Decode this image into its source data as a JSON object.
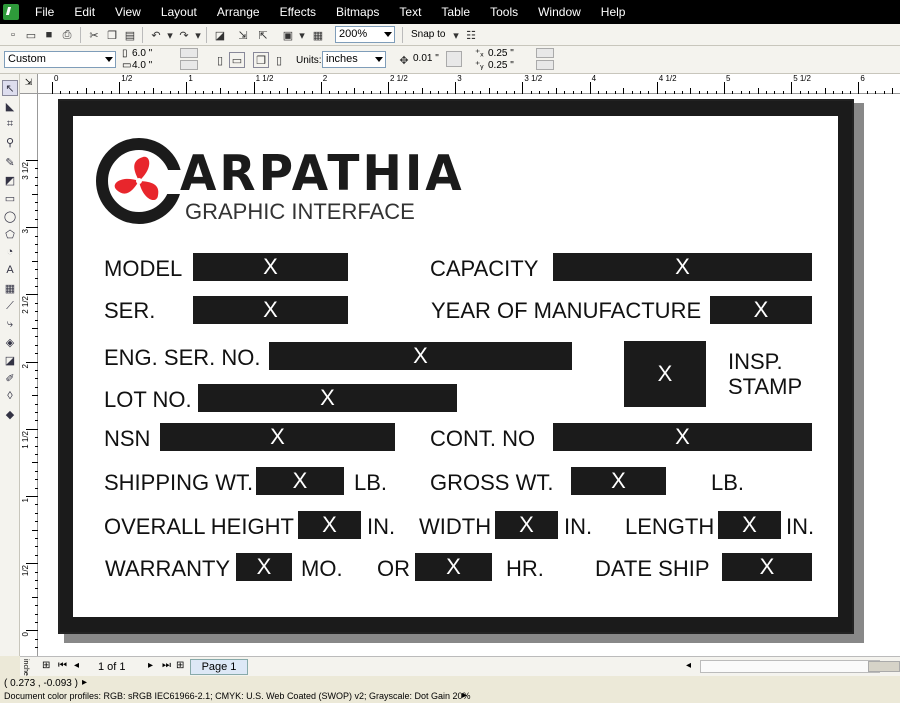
{
  "menu": [
    "File",
    "Edit",
    "View",
    "Layout",
    "Arrange",
    "Effects",
    "Bitmaps",
    "Text",
    "Table",
    "Tools",
    "Window",
    "Help"
  ],
  "toolbar": {
    "zoom": "200%",
    "snap_to": "Snap to",
    "page_size": "Custom",
    "width": "6.0 \"",
    "height": "4.0 \"",
    "units_label": "Units:",
    "units": "inches",
    "nudge": "0.01 \"",
    "dup_x": "0.25 \"",
    "dup_y": "0.25 \""
  },
  "ruler": {
    "unit": "inches",
    "top_labels": [
      "0",
      "1/2",
      "1",
      "1 1/2",
      "2",
      "2 1/2",
      "3",
      "3 1/2",
      "4",
      "4 1/2",
      "5",
      "5 1/2",
      "6"
    ],
    "left_labels": [
      "3 1/2",
      "3",
      "2 1/2",
      "2",
      "1 1/2",
      "1",
      "1/2",
      "0"
    ]
  },
  "label": {
    "brand": "ARPATHIA",
    "tagline": "GRAPHIC INTERFACE",
    "placeholder": "X",
    "fields": {
      "model": "MODEL",
      "capacity": "CAPACITY",
      "ser": "SER.",
      "year": "YEAR OF MANUFACTURE",
      "eng_ser": "ENG. SER. NO.",
      "insp": "INSP.",
      "stamp": "STAMP",
      "lot": "LOT NO.",
      "nsn": "NSN",
      "cont": "CONT. NO",
      "ship_wt": "SHIPPING WT.",
      "lb1": "LB.",
      "gross": "GROSS WT.",
      "lb2": "LB.",
      "overall": "OVERALL HEIGHT",
      "in1": "IN.",
      "width": "WIDTH",
      "in2": "IN.",
      "length": "LENGTH",
      "in3": "IN.",
      "warranty": "WARRANTY",
      "mo": "MO.",
      "or": "OR",
      "hr": "HR.",
      "date_ship": "DATE SHIP"
    }
  },
  "pagebar": {
    "count": "1 of 1",
    "page_tab": "Page 1"
  },
  "status": {
    "coords": "( 0.273 , -0.093 )",
    "profiles": "Document color profiles: RGB: sRGB IEC61966-2.1; CMYK: U.S. Web Coated (SWOP) v2; Grayscale: Dot Gain 20%"
  },
  "colors": {
    "logo_red": "#e8262c",
    "label_black": "#1b1b1b",
    "app_green": "#2e9a3a"
  }
}
